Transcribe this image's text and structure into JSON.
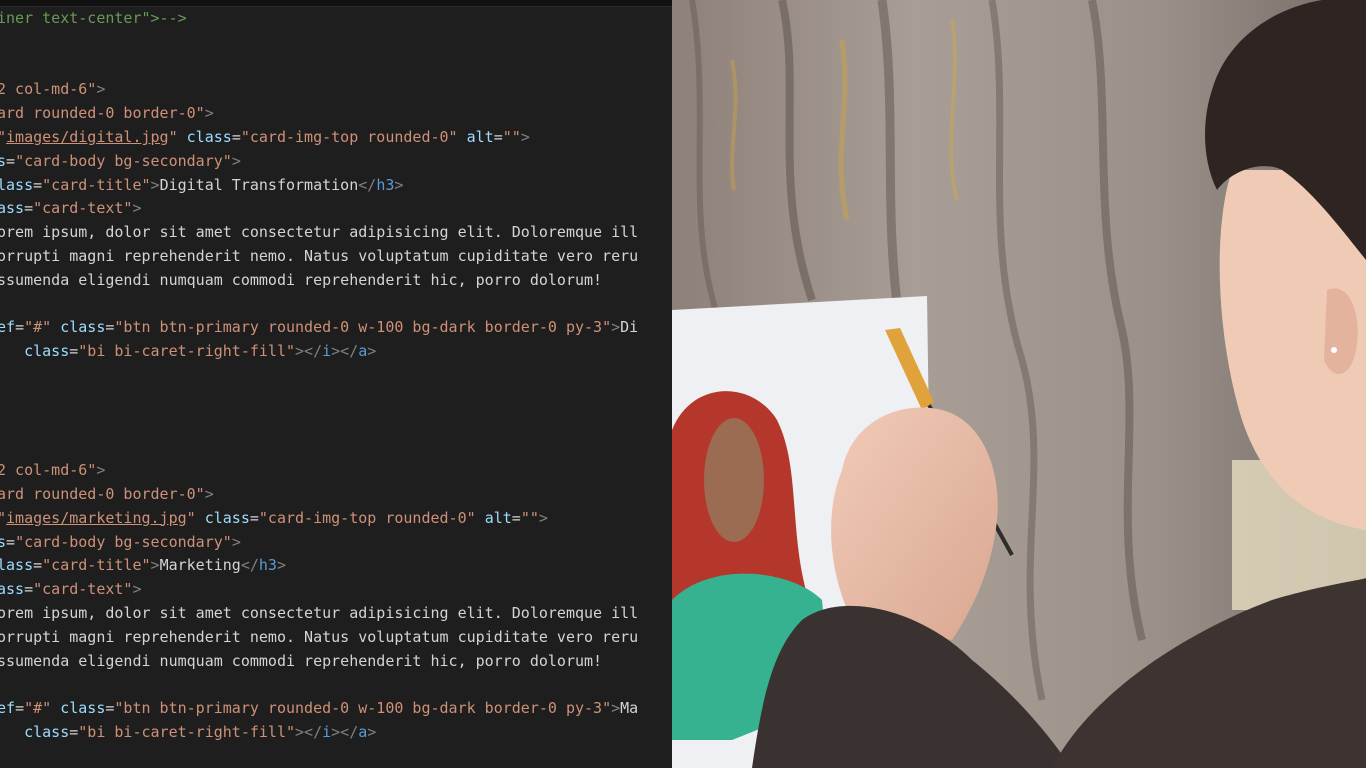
{
  "editor": {
    "lines": [
      [
        {
          "c": "cmt",
          "t": "iner text-center\">-->"
        }
      ],
      [],
      [],
      [
        {
          "c": "str",
          "t": "2 col-md-6\""
        },
        {
          "c": "tag",
          "t": ">"
        }
      ],
      [
        {
          "c": "str",
          "t": "ard rounded-0 border-0\""
        },
        {
          "c": "tag",
          "t": ">"
        }
      ],
      [
        {
          "c": "str",
          "t": "\""
        },
        {
          "c": "str link",
          "t": "images/digital.jpg"
        },
        {
          "c": "str",
          "t": "\""
        },
        {
          "c": "txt",
          "t": " "
        },
        {
          "c": "attr",
          "t": "class"
        },
        {
          "c": "txt",
          "t": "="
        },
        {
          "c": "str",
          "t": "\"card-img-top rounded-0\""
        },
        {
          "c": "txt",
          "t": " "
        },
        {
          "c": "attr",
          "t": "alt"
        },
        {
          "c": "txt",
          "t": "="
        },
        {
          "c": "str",
          "t": "\"\""
        },
        {
          "c": "tag",
          "t": ">"
        }
      ],
      [
        {
          "c": "attr",
          "t": "s"
        },
        {
          "c": "txt",
          "t": "="
        },
        {
          "c": "str",
          "t": "\"card-body bg-secondary\""
        },
        {
          "c": "tag",
          "t": ">"
        }
      ],
      [
        {
          "c": "attr",
          "t": "lass"
        },
        {
          "c": "txt",
          "t": "="
        },
        {
          "c": "str",
          "t": "\"card-title\""
        },
        {
          "c": "tag",
          "t": ">"
        },
        {
          "c": "txt",
          "t": "Digital Transformation"
        },
        {
          "c": "tag",
          "t": "</"
        },
        {
          "c": "tname",
          "t": "h3"
        },
        {
          "c": "tag",
          "t": ">"
        }
      ],
      [
        {
          "c": "attr",
          "t": "ass"
        },
        {
          "c": "txt",
          "t": "="
        },
        {
          "c": "str",
          "t": "\"card-text\""
        },
        {
          "c": "tag",
          "t": ">"
        }
      ],
      [
        {
          "c": "txt",
          "t": "orem ipsum, dolor sit amet consectetur adipisicing elit. Doloremque ill"
        }
      ],
      [
        {
          "c": "txt",
          "t": "orrupti magni reprehenderit nemo. Natus voluptatum cupiditate vero reru"
        }
      ],
      [
        {
          "c": "txt",
          "t": "ssumenda eligendi numquam commodi reprehenderit hic, porro dolorum!"
        }
      ],
      [],
      [
        {
          "c": "attr",
          "t": "ef"
        },
        {
          "c": "txt",
          "t": "="
        },
        {
          "c": "str",
          "t": "\"#\""
        },
        {
          "c": "txt",
          "t": " "
        },
        {
          "c": "attr",
          "t": "class"
        },
        {
          "c": "txt",
          "t": "="
        },
        {
          "c": "str",
          "t": "\"btn btn-primary rounded-0 w-100 bg-dark border-0 py-3\""
        },
        {
          "c": "tag",
          "t": ">"
        },
        {
          "c": "txt",
          "t": "Di"
        }
      ],
      [
        {
          "c": "txt",
          "t": "   "
        },
        {
          "c": "attr",
          "t": "class"
        },
        {
          "c": "txt",
          "t": "="
        },
        {
          "c": "str",
          "t": "\"bi bi-caret-right-fill\""
        },
        {
          "c": "tag",
          "t": "></"
        },
        {
          "c": "tname",
          "t": "i"
        },
        {
          "c": "tag",
          "t": "></"
        },
        {
          "c": "tname",
          "t": "a"
        },
        {
          "c": "tag",
          "t": ">"
        }
      ],
      [],
      [],
      [],
      [],
      [
        {
          "c": "str",
          "t": "2 col-md-6\""
        },
        {
          "c": "tag",
          "t": ">"
        }
      ],
      [
        {
          "c": "str",
          "t": "ard rounded-0 border-0\""
        },
        {
          "c": "tag",
          "t": ">"
        }
      ],
      [
        {
          "c": "str",
          "t": "\""
        },
        {
          "c": "str link",
          "t": "images/marketing.jpg"
        },
        {
          "c": "str",
          "t": "\""
        },
        {
          "c": "txt",
          "t": " "
        },
        {
          "c": "attr",
          "t": "class"
        },
        {
          "c": "txt",
          "t": "="
        },
        {
          "c": "str",
          "t": "\"card-img-top rounded-0\""
        },
        {
          "c": "txt",
          "t": " "
        },
        {
          "c": "attr",
          "t": "alt"
        },
        {
          "c": "txt",
          "t": "="
        },
        {
          "c": "str",
          "t": "\"\""
        },
        {
          "c": "tag",
          "t": ">"
        }
      ],
      [
        {
          "c": "attr",
          "t": "s"
        },
        {
          "c": "txt",
          "t": "="
        },
        {
          "c": "str",
          "t": "\"card-body bg-secondary\""
        },
        {
          "c": "tag",
          "t": ">"
        }
      ],
      [
        {
          "c": "attr",
          "t": "lass"
        },
        {
          "c": "txt",
          "t": "="
        },
        {
          "c": "str",
          "t": "\"card-title\""
        },
        {
          "c": "tag",
          "t": ">"
        },
        {
          "c": "txt",
          "t": "Marketing"
        },
        {
          "c": "tag",
          "t": "</"
        },
        {
          "c": "tname",
          "t": "h3"
        },
        {
          "c": "tag",
          "t": ">"
        }
      ],
      [
        {
          "c": "attr",
          "t": "ass"
        },
        {
          "c": "txt",
          "t": "="
        },
        {
          "c": "str",
          "t": "\"card-text\""
        },
        {
          "c": "tag",
          "t": ">"
        }
      ],
      [
        {
          "c": "txt",
          "t": "orem ipsum, dolor sit amet consectetur adipisicing elit. Doloremque ill"
        }
      ],
      [
        {
          "c": "txt",
          "t": "orrupti magni reprehenderit nemo. Natus voluptatum cupiditate vero reru"
        }
      ],
      [
        {
          "c": "txt",
          "t": "ssumenda eligendi numquam commodi reprehenderit hic, porro dolorum!"
        }
      ],
      [],
      [
        {
          "c": "attr",
          "t": "ef"
        },
        {
          "c": "txt",
          "t": "="
        },
        {
          "c": "str",
          "t": "\"#\""
        },
        {
          "c": "txt",
          "t": " "
        },
        {
          "c": "attr",
          "t": "class"
        },
        {
          "c": "txt",
          "t": "="
        },
        {
          "c": "str",
          "t": "\"btn btn-primary rounded-0 w-100 bg-dark border-0 py-3\""
        },
        {
          "c": "tag",
          "t": ">"
        },
        {
          "c": "txt",
          "t": "Ma"
        }
      ],
      [
        {
          "c": "txt",
          "t": "   "
        },
        {
          "c": "attr",
          "t": "class"
        },
        {
          "c": "txt",
          "t": "="
        },
        {
          "c": "str",
          "t": "\"bi bi-caret-right-fill\""
        },
        {
          "c": "tag",
          "t": "></"
        },
        {
          "c": "tname",
          "t": "i"
        },
        {
          "c": "tag",
          "t": "></"
        },
        {
          "c": "tname",
          "t": "a"
        },
        {
          "c": "tag",
          "t": ">"
        }
      ]
    ]
  },
  "colors": {
    "editor_bg": "#1e1e1e",
    "tag": "#808080",
    "tag_name": "#569cd6",
    "attribute": "#9cdcfe",
    "string": "#ce9178",
    "text": "#d4d4d4",
    "comment": "#6a9955"
  }
}
